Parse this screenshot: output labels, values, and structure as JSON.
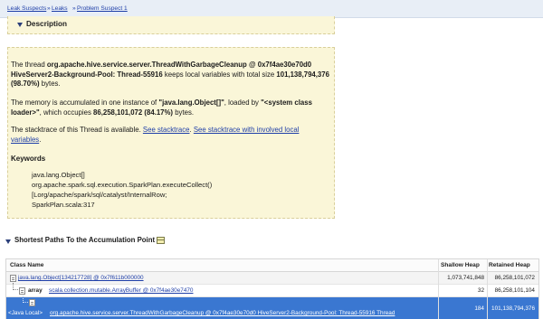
{
  "breadcrumb": {
    "items": [
      "Leak Suspects",
      "Leaks",
      "Problem Suspect 1"
    ],
    "sep": "»"
  },
  "description": {
    "title": "Description",
    "p1": {
      "pre": "The thread ",
      "thread": "org.apache.hive.service.server.ThreadWithGarbageCleanup @ 0x7f4ae30e70d0 HiveServer2-Background-Pool: Thread-55916",
      "mid": " keeps local variables with total size ",
      "size": "101,138,794,376 (98.70%)",
      "post": " bytes."
    },
    "p2": {
      "pre": "The memory is accumulated in one instance of ",
      "type": "\"java.lang.Object[]\"",
      "mid": ", loaded by ",
      "loader": "\"<system class loader>\"",
      "mid2": ", which occupies ",
      "size": "86,258,101,072 (84.17%)",
      "post": " bytes."
    },
    "p3": {
      "pre": "The stacktrace of this Thread is available. ",
      "link1": "See stacktrace",
      "sep": ". ",
      "link2": "See stacktrace with involved local variables",
      "post": "."
    },
    "keywords_title": "Keywords",
    "keywords": [
      "java.lang.Object[]",
      "org.apache.spark.sql.execution.SparkPlan.executeCollect()",
      "[Lorg/apache/spark/sql/catalyst/InternalRow;",
      "SparkPlan.scala:317"
    ]
  },
  "shortest_paths": {
    "title": "Shortest Paths To the Accumulation Point",
    "columns": [
      "Class Name",
      "Shallow Heap",
      "Retained Heap"
    ],
    "rows": [
      {
        "prefix": "",
        "name": "java.lang.Object[134217728] @ 0x7f611b000000",
        "shallow": "1,073,741,848",
        "retained": "86,258,101,072"
      },
      {
        "prefix": "array",
        "name": "scala.collection.mutable.ArrayBuffer @ 0x7f4ae30e7470",
        "shallow": "32",
        "retained": "86,258,101,104"
      },
      {
        "prefix": "<Java Local>",
        "name": "org.apache.hive.service.server.ThreadWithGarbageCleanup @ 0x7f4ae30e70d0 HiveServer2-Background-Pool: Thread-55916 Thread",
        "shallow": "184",
        "retained": "101,138,794,376"
      }
    ]
  }
}
